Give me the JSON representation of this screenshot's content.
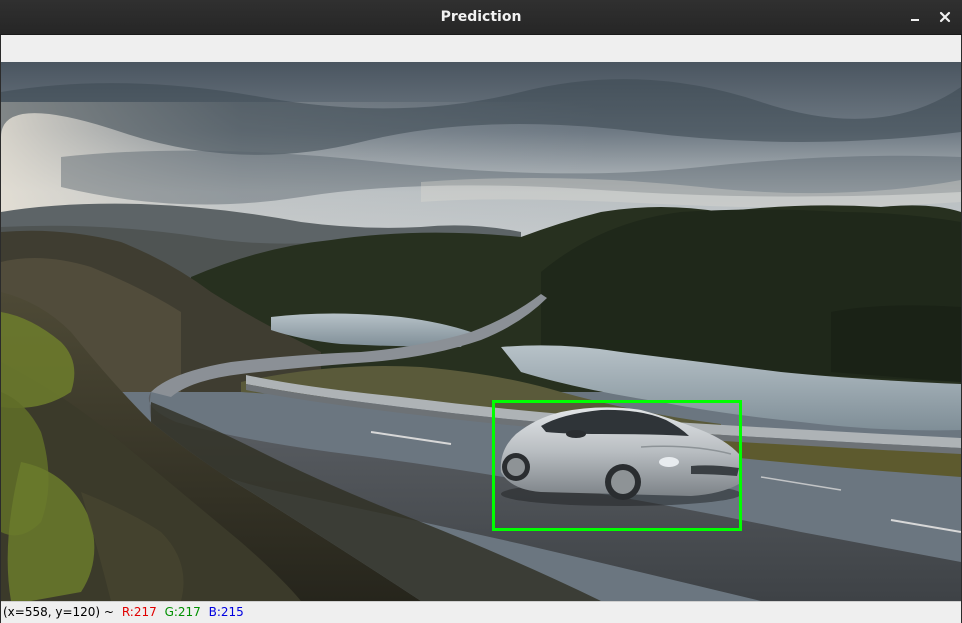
{
  "window": {
    "title": "Prediction"
  },
  "titlebar_buttons": {
    "minimize_icon": "minimize-icon",
    "close_icon": "close-icon"
  },
  "image": {
    "description_icon": "photo-canvas"
  },
  "detection": {
    "box_color": "#00ff00"
  },
  "statusbar": {
    "coords": "(x=558, y=120) ~",
    "r": "R:217",
    "g": "G:217",
    "b": "B:215",
    "r_color": "#e00000",
    "g_color": "#009000",
    "b_color": "#0000e0"
  }
}
